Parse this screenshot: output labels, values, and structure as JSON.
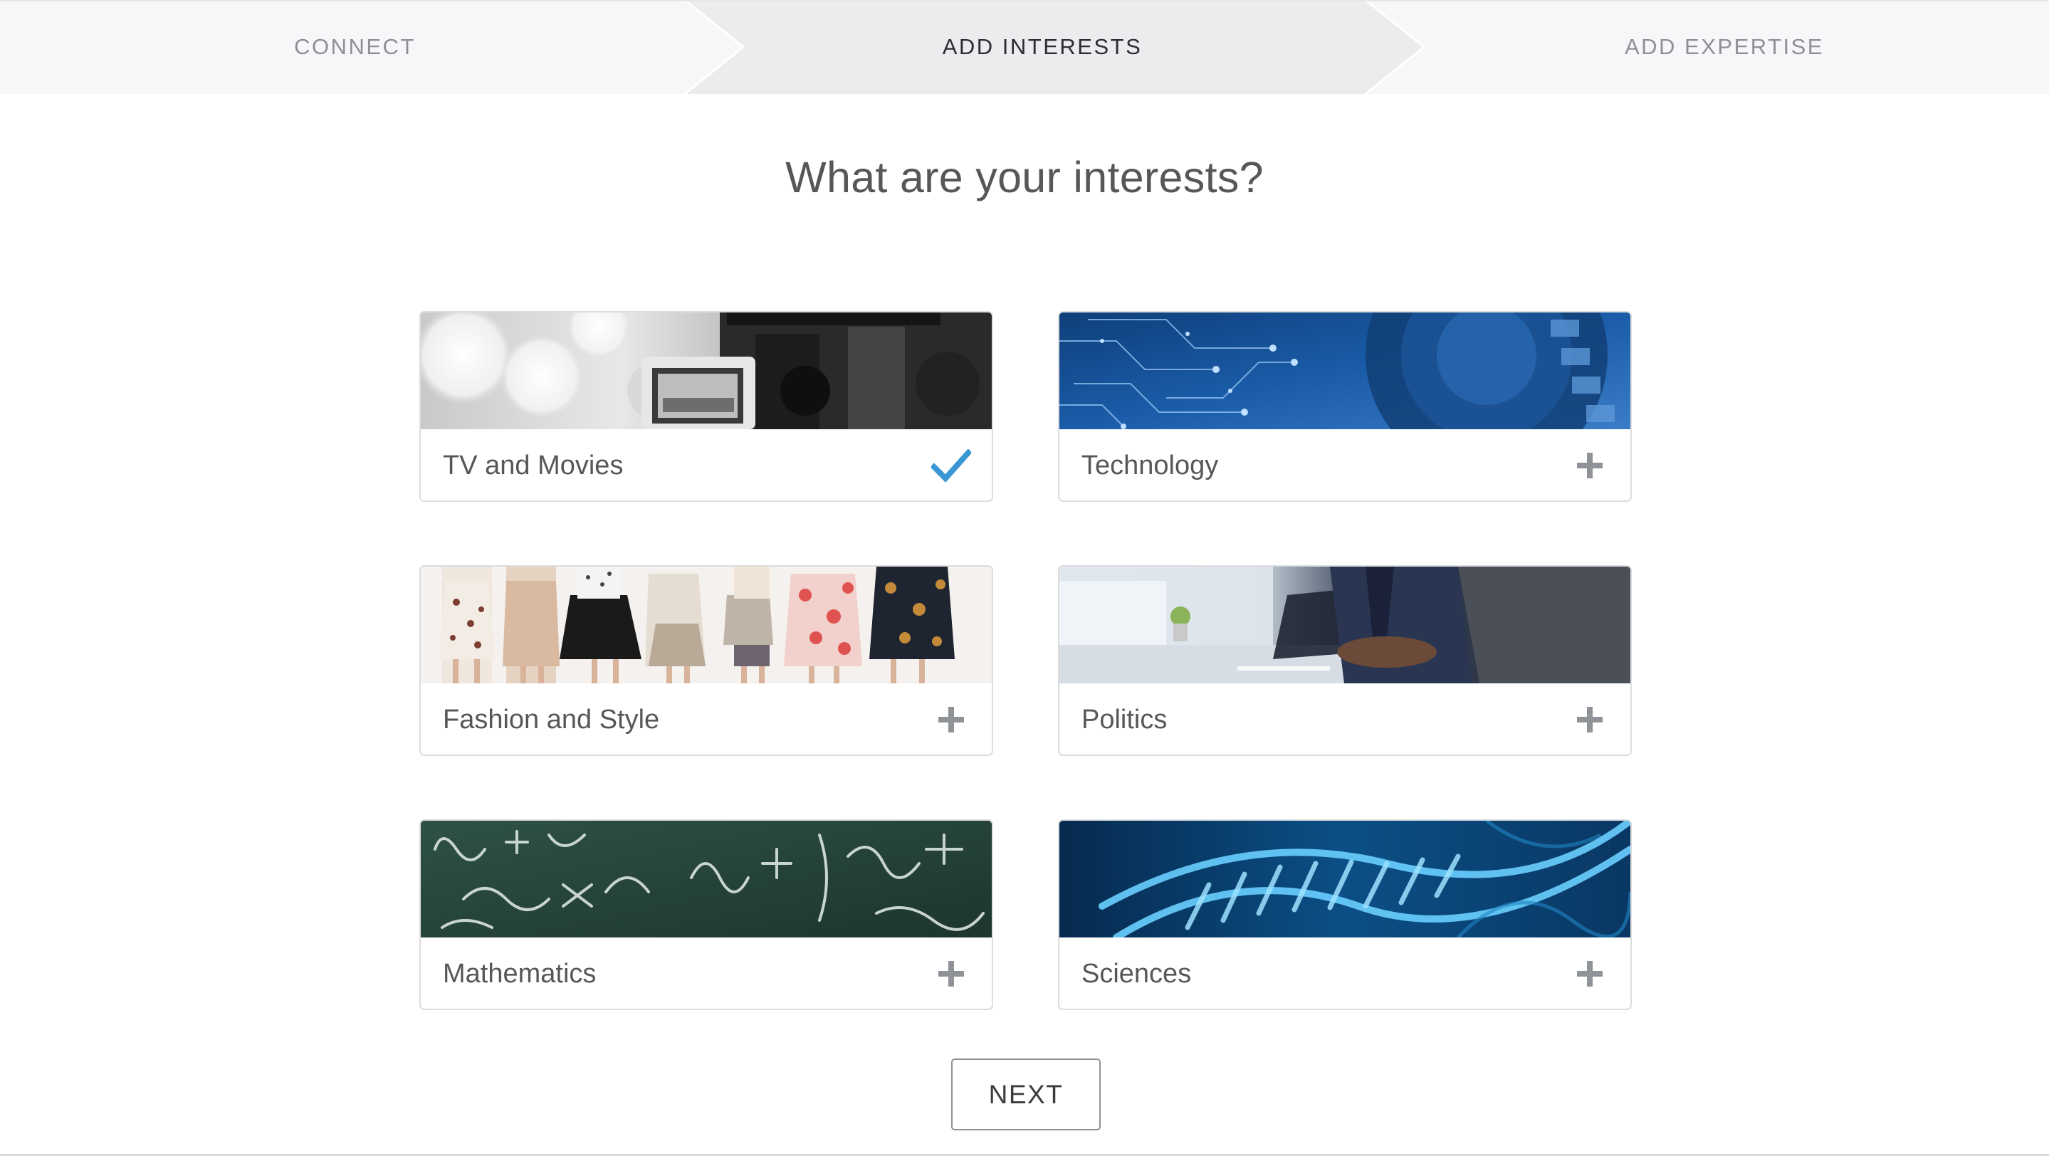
{
  "stepper": {
    "steps": [
      {
        "label": "CONNECT",
        "state": "done"
      },
      {
        "label": "ADD INTERESTS",
        "state": "active"
      },
      {
        "label": "ADD EXPERTISE",
        "state": "upcoming"
      }
    ]
  },
  "page": {
    "title": "What are your interests?"
  },
  "interests": [
    {
      "label": "TV and Movies",
      "selected": true,
      "icon": "check-icon"
    },
    {
      "label": "Technology",
      "selected": false,
      "icon": "plus-icon"
    },
    {
      "label": "Fashion and Style",
      "selected": false,
      "icon": "plus-icon"
    },
    {
      "label": "Politics",
      "selected": false,
      "icon": "plus-icon"
    },
    {
      "label": "Mathematics",
      "selected": false,
      "icon": "plus-icon"
    },
    {
      "label": "Sciences",
      "selected": false,
      "icon": "plus-icon"
    }
  ],
  "actions": {
    "next_label": "NEXT"
  },
  "colors": {
    "accent_check": "#3a97d4",
    "plus_icon": "#8f9296",
    "stepper_inactive_bg": "#f7f7f9",
    "stepper_active_bg": "#ececef"
  }
}
